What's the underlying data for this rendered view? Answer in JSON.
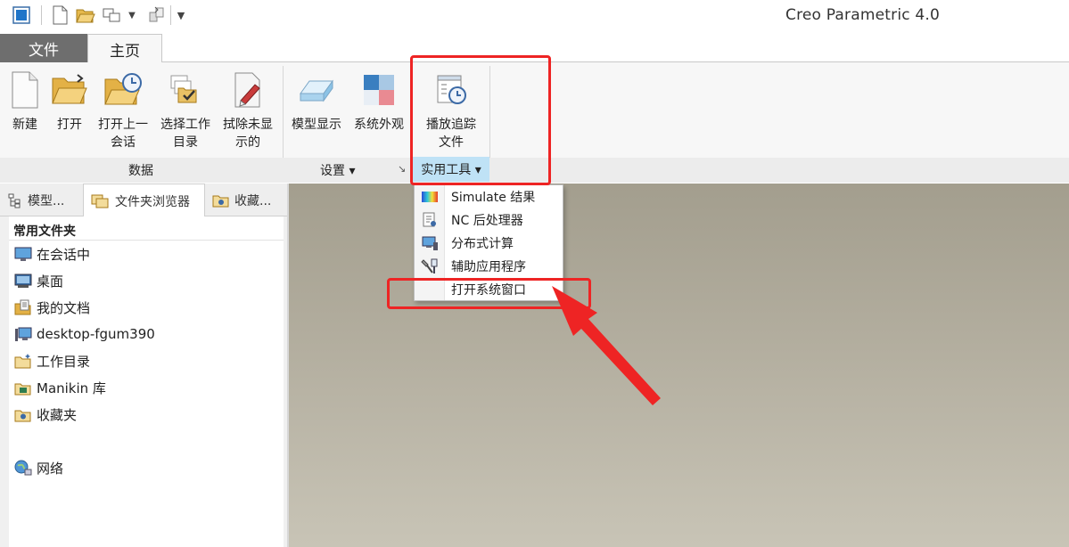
{
  "app": {
    "title": "Creo Parametric 4.0"
  },
  "quick_access": {
    "icons": [
      "window-icon",
      "new-icon",
      "open-icon",
      "windows-icon",
      "dropdown-arrow-icon",
      "regenerate-icon",
      "customize-arrow-icon"
    ]
  },
  "tabs": [
    {
      "label": "文件",
      "active": false
    },
    {
      "label": "主页",
      "active": true
    }
  ],
  "ribbon": {
    "buttons": {
      "new": "新建",
      "open": "打开",
      "open_last_1": "打开上一",
      "open_last_2": "会话",
      "select_dir_1": "选择工作",
      "select_dir_2": "目录",
      "erase_1": "拭除未显",
      "erase_2": "示的",
      "model_display": "模型显示",
      "system_appearance": "系统外观",
      "play_trail_1": "播放追踪",
      "play_trail_2": "文件"
    },
    "groups": {
      "data": "数据",
      "settings": "设置 ▾",
      "utilities": "实用工具 ▾"
    }
  },
  "navigator": {
    "tabs": [
      "模型...",
      "文件夹浏览器",
      "收藏..."
    ],
    "active_tab": "文件夹浏览器",
    "heading": "常用文件夹",
    "items": [
      "在会话中",
      "桌面",
      "我的文档",
      "desktop-fgum390",
      "工作目录",
      "Manikin 库",
      "收藏夹",
      "网络"
    ]
  },
  "utilities_menu": {
    "items": [
      "Simulate 结果",
      "NC 后处理器",
      "分布式计算",
      "辅助应用程序",
      "打开系统窗口"
    ]
  },
  "colors": {
    "highlight": "#ee2424",
    "ribbon_bg": "#f7f7f7",
    "file_tab": "#6e6e6e",
    "active_group": "#bfe2f6",
    "graphics_top": "#a39e8e",
    "graphics_bottom": "#c8c4b6"
  }
}
